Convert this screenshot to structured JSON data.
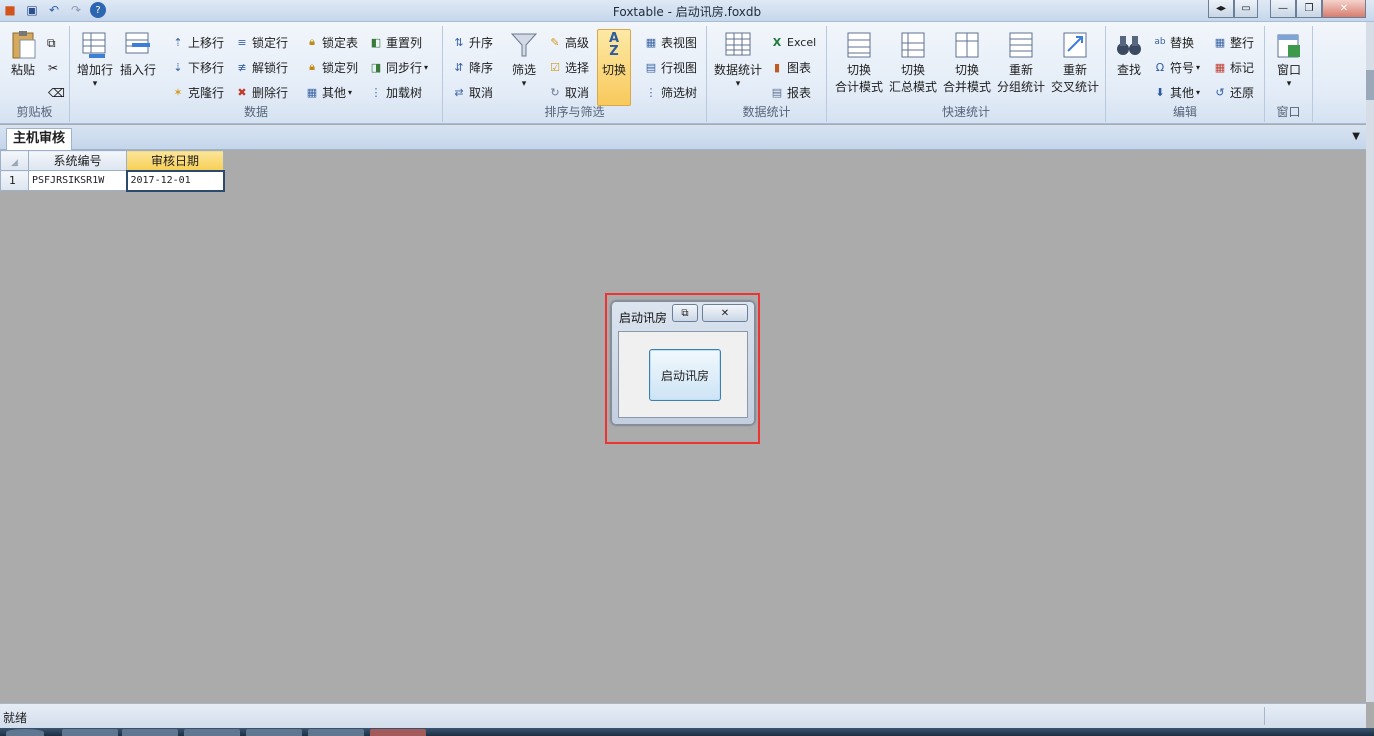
{
  "window": {
    "title": "Foxtable - 启动讯房.foxdb",
    "controls": [
      "◂▸",
      "▭",
      "—",
      "❐",
      "✕"
    ]
  },
  "ribbon": {
    "clipboard": {
      "group": "剪贴板",
      "paste": "粘贴"
    },
    "data": {
      "group": "数据",
      "add_row": "增加行",
      "insert_row": "插入行",
      "move_up": "上移行",
      "move_down": "下移行",
      "clone_row": "克隆行",
      "lock_row": "锁定行",
      "unlock_row": "解锁行",
      "delete_row": "删除行",
      "lock_table": "锁定表",
      "lock_col": "锁定列",
      "other": "其他",
      "reset_col": "重置列",
      "sync_row": "同步行",
      "load_tree": "加载树"
    },
    "sort": {
      "group": "排序与筛选",
      "asc": "升序",
      "desc": "降序",
      "cancel_sort": "取消",
      "filter": "筛选",
      "advanced": "高级",
      "select": "选择",
      "cancel_filter": "取消",
      "toggle": "切换",
      "table_view": "表视图",
      "row_view": "行视图",
      "filter_tree": "筛选树"
    },
    "stats": {
      "group": "数据统计",
      "data_stats": "数据统计",
      "excel": "Excel",
      "chart": "图表",
      "report": "报表"
    },
    "quick": {
      "group": "快速统计",
      "b1_l1": "切换",
      "b1_l2": "合计模式",
      "b2_l1": "切换",
      "b2_l2": "汇总模式",
      "b3_l1": "切换",
      "b3_l2": "合并模式",
      "b4_l1": "重新",
      "b4_l2": "分组统计",
      "b5_l1": "重新",
      "b5_l2": "交叉统计"
    },
    "edit": {
      "group": "编辑",
      "find": "查找",
      "replace": "替换",
      "symbol": "符号",
      "other": "其他",
      "tidy_row": "整行",
      "mark": "标记",
      "restore": "还原"
    },
    "window": {
      "group": "窗口",
      "window": "窗口"
    }
  },
  "tabs": {
    "active": "主机审核"
  },
  "grid": {
    "columns": [
      "系统编号",
      "审核日期"
    ],
    "rows": [
      {
        "num": "1",
        "cells": [
          "PSFJRSIKSR1W",
          "2017-12-01"
        ]
      }
    ]
  },
  "dialog": {
    "title": "启动讯房",
    "button": "启动讯房"
  },
  "status": {
    "text": "就绪"
  }
}
